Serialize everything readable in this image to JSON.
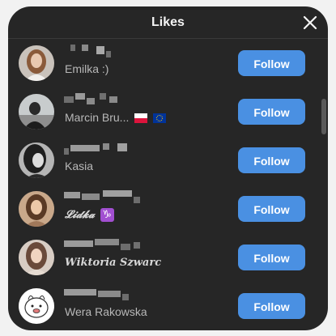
{
  "modal": {
    "title": "Likes",
    "close_icon": "close-icon"
  },
  "follow_label": "Follow",
  "rows": [
    {
      "fullname": "Emilka :)",
      "avatar": "avatar-photo"
    },
    {
      "fullname": "Marcin Bru...",
      "flags": [
        "poland-flag-icon",
        "eu-flag-icon"
      ],
      "avatar": "avatar-photo"
    },
    {
      "fullname": "Kasia",
      "avatar": "avatar-photo"
    },
    {
      "fullname": "𝓛𝓲𝓭𝓴𝓪",
      "zodiac": "♑",
      "zodiac_icon": "capricorn-icon",
      "avatar": "avatar-photo"
    },
    {
      "fullname": "𝑾𝒊𝒌𝒕𝒐𝒓𝒊𝒂 𝑺𝒛𝒘𝒂𝒓𝒄",
      "avatar": "avatar-photo"
    },
    {
      "fullname": "Wera Rakowska",
      "avatar": "avatar-drawing"
    }
  ],
  "colors": {
    "background": "#262626",
    "button": "#4a90e2",
    "text": "#f5f5f5",
    "subtext": "#b8b8b8"
  }
}
